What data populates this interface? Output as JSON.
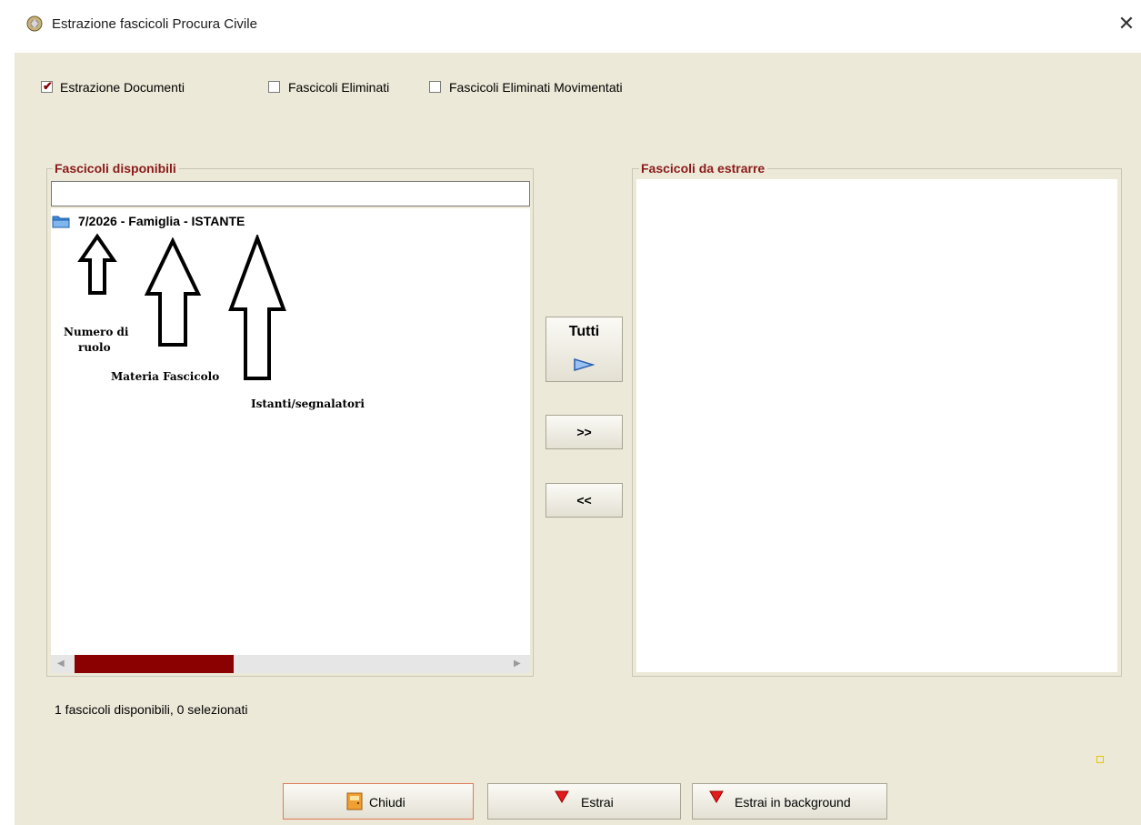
{
  "window": {
    "title": "Estrazione fascicoli Procura Civile",
    "close_glyph": "✕"
  },
  "options": {
    "estrazione_documenti": {
      "label": "Estrazione Documenti",
      "checked": true
    },
    "fascicoli_eliminati": {
      "label": "Fascicoli Eliminati",
      "checked": false
    },
    "fascicoli_eliminati_movimentati": {
      "label": "Fascicoli Eliminati Movimentati",
      "checked": false
    }
  },
  "left_panel": {
    "title": "Fascicoli disponibili",
    "filter_value": "",
    "items": [
      {
        "label": "7/2026 - Famiglia - ISTANTE",
        "icon": "folder-icon"
      }
    ]
  },
  "right_panel": {
    "title": "Fascicoli da estrarre",
    "items": []
  },
  "transfer_buttons": {
    "tutti_label": "Tutti",
    "add_label": ">>",
    "remove_label": "<<"
  },
  "annotations": {
    "numero_di_ruolo_line1": "Numero di",
    "numero_di_ruolo_line2": "ruolo",
    "materia_fascicolo": "Materia Fascicolo",
    "istanti_segnalatori": "Istanti/segnalatori"
  },
  "status": {
    "text": "1 fascicoli disponibili, 0 selezionati"
  },
  "footer_buttons": {
    "chiudi": "Chiudi",
    "estrai": "Estrai",
    "estrai_background": "Estrai in background"
  },
  "colors": {
    "dialog_background": "#ece9d8",
    "group_title": "#8b1a1a",
    "scroll_thumb": "#8b0000",
    "check_mark": "#8b0000"
  }
}
